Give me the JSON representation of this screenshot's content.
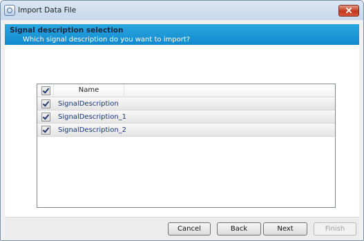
{
  "window": {
    "title": "Import Data File"
  },
  "header": {
    "title": "Signal description selection",
    "subtitle": "Which signal description do you want to import?"
  },
  "list": {
    "column_name": "Name",
    "header_checked": true,
    "rows": [
      {
        "label": "SignalDescription",
        "checked": true
      },
      {
        "label": "SignalDescription_1",
        "checked": true
      },
      {
        "label": "SignalDescription_2",
        "checked": true
      }
    ]
  },
  "buttons": {
    "cancel": "Cancel",
    "back": "Back",
    "next": "Next",
    "finish": "Finish",
    "finish_enabled": false
  }
}
